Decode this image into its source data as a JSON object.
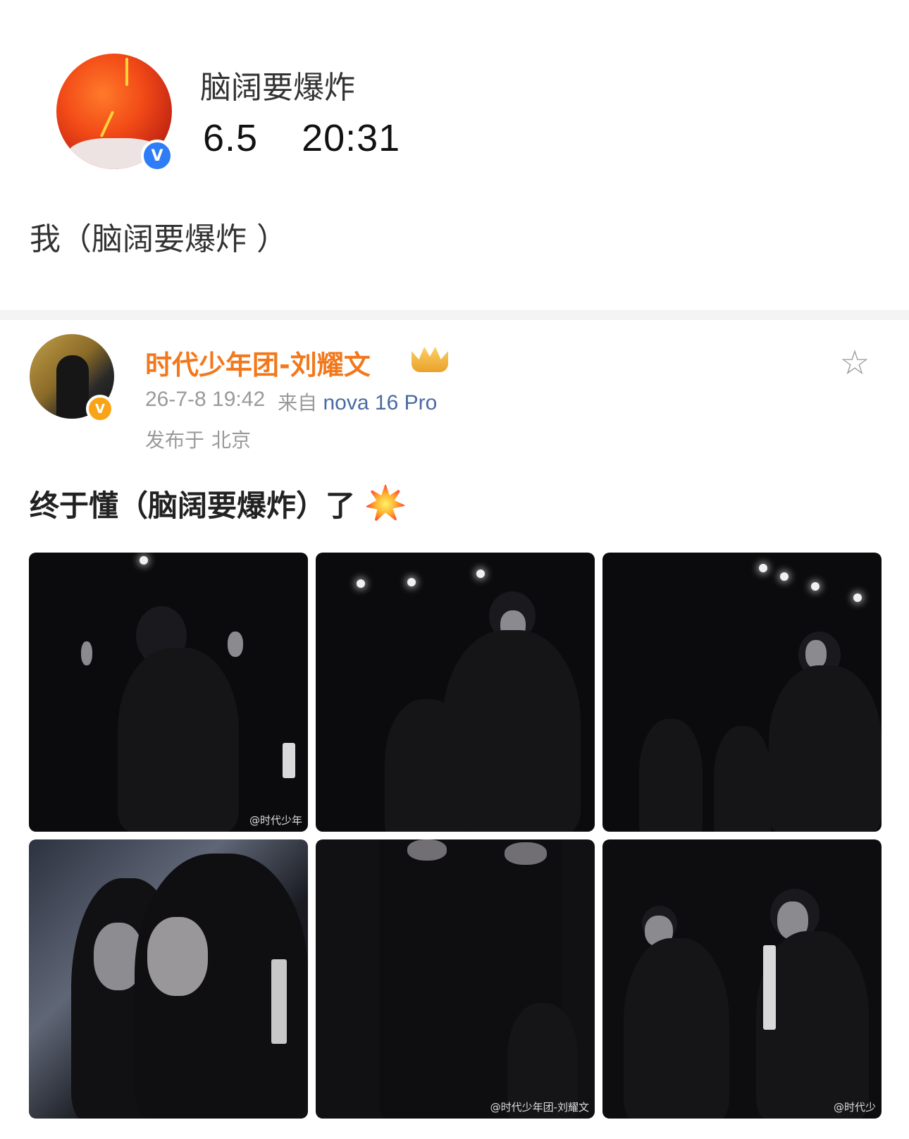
{
  "top_post": {
    "username": "脑阔要爆炸",
    "date": "6.5",
    "time": "20:31",
    "text": "我（脑阔要爆炸 ）",
    "verified_badge": "V"
  },
  "post": {
    "author": "时代少年团-刘耀文",
    "verified_badge": "V",
    "timestamp": "26-7-8 19:42",
    "from_label": "来自",
    "device": "nova 16 Pro",
    "location_label": "发布于",
    "location": "北京",
    "text": "终于懂（脑阔要爆炸）了",
    "icons": {
      "crown": "crown-icon",
      "favorite": "star-icon",
      "emoji": "collision-emoji-icon"
    },
    "star_glyph": "☆",
    "images": [
      {
        "watermark": "@时代少年"
      },
      {
        "watermark": ""
      },
      {
        "watermark": ""
      },
      {
        "watermark": ""
      },
      {
        "watermark": "@时代少年团-刘耀文"
      },
      {
        "watermark": "@时代少"
      }
    ]
  },
  "colors": {
    "author": "#f2781c",
    "meta": "#9a9a9a",
    "device": "#4a6aa5",
    "verified_blue": "#2e7cf6",
    "verified_orange": "#f8a416"
  }
}
